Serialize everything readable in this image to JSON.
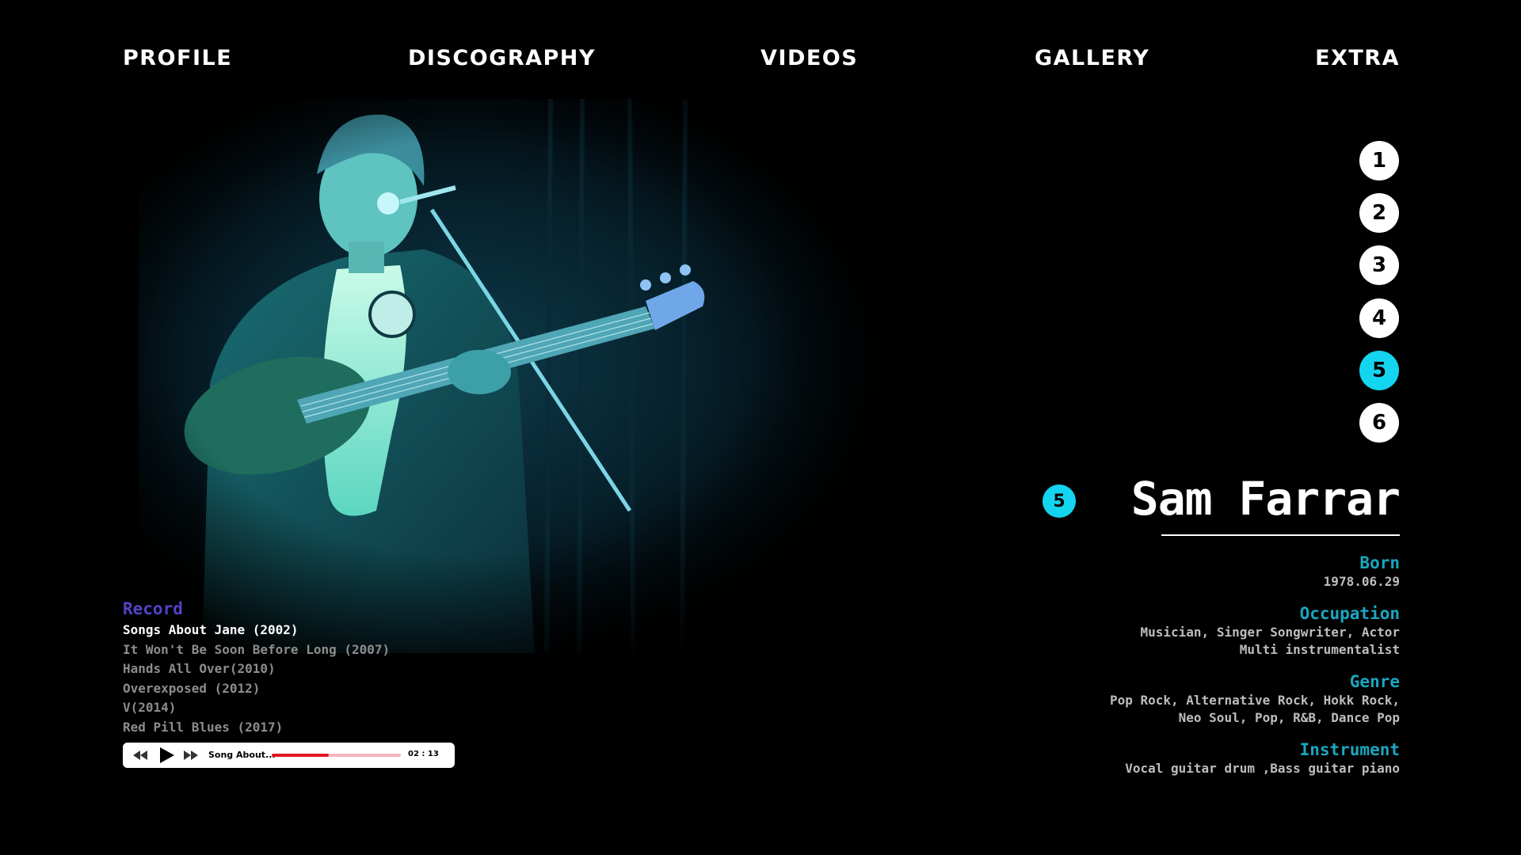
{
  "nav": [
    "PROFILE",
    "DISCOGRAPHY",
    "VIDEOS",
    "GALLERY",
    "EXTRA"
  ],
  "pager": {
    "items": [
      "1",
      "2",
      "3",
      "4",
      "5",
      "6"
    ],
    "active": "5"
  },
  "profile": {
    "badge": "5",
    "name": "Sam Farrar",
    "born_label": "Born",
    "born_value": "1978.06.29",
    "occupation_label": "Occupation",
    "occupation_value_1": "Musician, Singer Songwriter, Actor",
    "occupation_value_2": "Multi instrumentalist",
    "genre_label": "Genre",
    "genre_value_1": "Pop Rock, Alternative Rock, Hokk Rock,",
    "genre_value_2": "Neo Soul, Pop, R&B, Dance Pop",
    "instrument_label": "Instrument",
    "instrument_value": "Vocal guitar drum ,Bass guitar piano"
  },
  "record": {
    "title": "Record",
    "items": [
      "Songs About Jane (2002)",
      "It Won't Be Soon Before Long (2007)",
      "Hands All Over(2010)",
      "Overexposed (2012)",
      "V(2014)",
      "Red Pill Blues (2017)"
    ],
    "active_index": 0
  },
  "player": {
    "track": "Song About...",
    "time": "02 : 13",
    "progress": 0.44,
    "icons": [
      "rewind-icon",
      "play-icon",
      "fast-forward-icon"
    ]
  },
  "colors": {
    "accent": "#14d5f0",
    "label": "#1aa6bf",
    "record_title": "#5143c8",
    "progress": "#e01623"
  }
}
